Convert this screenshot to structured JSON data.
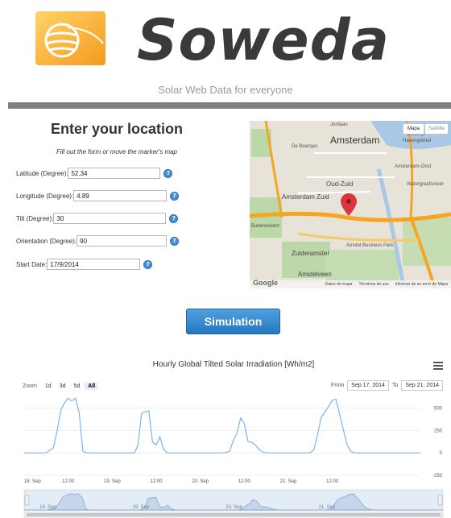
{
  "header": {
    "brand": "Soweda",
    "tagline": "Solar Web Data for everyone"
  },
  "form": {
    "title": "Enter your location",
    "hint": "Fill out the form or move the marker's map",
    "fields": [
      {
        "label": "Latitude (Degree):",
        "value": "52.34"
      },
      {
        "label": "Longitude (Degree):",
        "value": "4.89"
      },
      {
        "label": "Tilt (Degree):",
        "value": "30"
      },
      {
        "label": "Orientation (Degree):",
        "value": "90"
      },
      {
        "label": "Start Date:",
        "value": "17/9/2014"
      }
    ],
    "help_glyph": "?"
  },
  "map": {
    "buttons": {
      "map": "Mapa",
      "satellite": "Satélite"
    },
    "labels": {
      "city": "Amsterdam",
      "south": "Amsterdam Zuid",
      "oud_zuid": "Oud-Zuid",
      "zuideramstel": "Zuideramstel",
      "amstelveen": "Amstelveen",
      "oosterlijk": "Oostelijk",
      "havengebied": "Havengebied",
      "oost": "Amsterdam-Oost",
      "watergraafsmeer": "Watergraafsmeer",
      "jordaan": "Jordaan",
      "de_baarsjes": "De Baarsjes",
      "business": "Amstel Business Park",
      "buitenveldert": "Buitenveldert"
    },
    "logo": "Google",
    "footer": [
      "Datos de mapa",
      "Términos de uso",
      "Informar de un error de Mapa"
    ],
    "colors": {
      "marker": "#d9363e",
      "highway": "#f4a623",
      "park": "#bcd7a8",
      "water": "#a9c8e6"
    }
  },
  "simulation_label": "Simulation",
  "chart": {
    "title": "Hourly Global Tilted Solar Irradiation [Wh/m2]",
    "zoom_label": "Zoom",
    "zoom_buttons": [
      "1d",
      "3d",
      "5d",
      "All"
    ],
    "active_zoom": "All",
    "from_label": "From",
    "from_value": "Sep 17, 2014",
    "to_label": "To",
    "to_value": "Sep 21, 2014",
    "navigator_labels": [
      "18. Sep",
      "19. Sep",
      "20. Sep",
      "21. Sep"
    ]
  },
  "chart_data": {
    "type": "line",
    "title": "Hourly Global Tilted Solar Irradiation [Wh/m2]",
    "x_tick_labels": [
      "18. Sep",
      "12:00",
      "19. Sep",
      "12:00",
      "20. Sep",
      "12:00",
      "21. Sep",
      "12:00"
    ],
    "y_tick_labels": [
      "500",
      "250",
      "0",
      "-250"
    ],
    "ylim": [
      -250,
      650
    ],
    "x_hours_domain": [
      0,
      108
    ],
    "series": [
      {
        "color": "#7cb5ec",
        "x": [
          0,
          6,
          8,
          9,
          10,
          11,
          12,
          13,
          14,
          15,
          16,
          17,
          18,
          24,
          30,
          31,
          32,
          33,
          34,
          35,
          36,
          37,
          38,
          39,
          40,
          42,
          48,
          54,
          55,
          56,
          57,
          58,
          59,
          60,
          61,
          62,
          63,
          64,
          65,
          66,
          72,
          78,
          79,
          80,
          81,
          82,
          83,
          84,
          85,
          86,
          87,
          88,
          89,
          90,
          96,
          102,
          104,
          105,
          106,
          107,
          108
        ],
        "y": [
          0,
          0,
          60,
          250,
          480,
          560,
          610,
          580,
          610,
          450,
          20,
          0,
          0,
          0,
          0,
          80,
          440,
          460,
          470,
          120,
          90,
          180,
          40,
          0,
          0,
          0,
          0,
          0,
          5,
          20,
          140,
          220,
          390,
          330,
          130,
          120,
          90,
          40,
          10,
          0,
          0,
          0,
          40,
          210,
          400,
          460,
          520,
          590,
          600,
          430,
          260,
          90,
          20,
          0,
          0,
          0,
          0,
          0,
          0,
          0,
          0
        ]
      }
    ],
    "grid": true
  }
}
